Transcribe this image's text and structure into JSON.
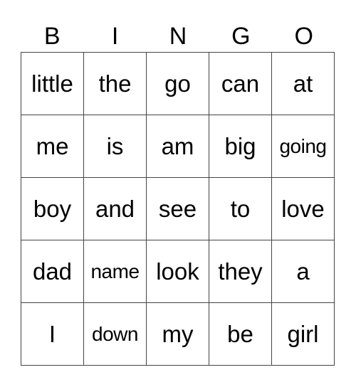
{
  "header": {
    "letters": [
      "B",
      "I",
      "N",
      "G",
      "O"
    ]
  },
  "grid": {
    "rows": [
      [
        "little",
        "the",
        "go",
        "can",
        "at"
      ],
      [
        "me",
        "is",
        "am",
        "big",
        "going"
      ],
      [
        "boy",
        "and",
        "see",
        "to",
        "love"
      ],
      [
        "dad",
        "name",
        "look",
        "they",
        "a"
      ],
      [
        "I",
        "down",
        "my",
        "be",
        "girl"
      ]
    ]
  }
}
